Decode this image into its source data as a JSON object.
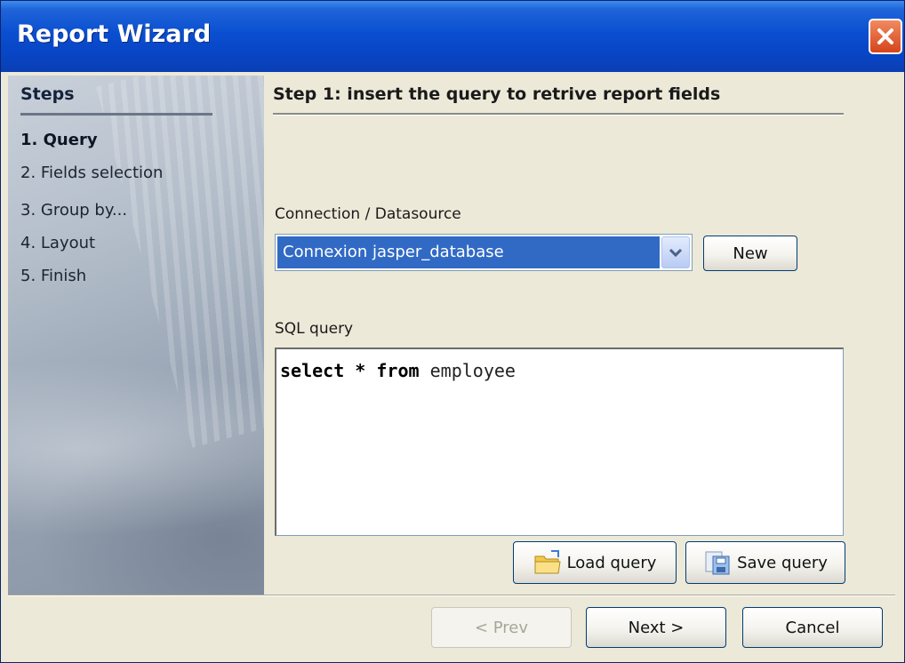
{
  "window": {
    "title": "Report Wizard"
  },
  "steps": {
    "title": "Steps",
    "items": [
      {
        "label": "1. Query",
        "active": true
      },
      {
        "label": "2. Fields selection",
        "active": false
      },
      {
        "label": "3. Group by...",
        "active": false
      },
      {
        "label": "4. Layout",
        "active": false
      },
      {
        "label": "5. Finish",
        "active": false
      }
    ]
  },
  "content": {
    "title": "Step 1: insert the query to retrive report fields",
    "connection_label": "Connection / Datasource",
    "connection_value": "Connexion jasper_database",
    "new_button": "New",
    "sql_label": "SQL query",
    "sql_keyword_1": "select",
    "sql_operator": "*",
    "sql_keyword_2": "from",
    "sql_table": "employee",
    "load_query_button": "Load query",
    "save_query_button": "Save query"
  },
  "footer": {
    "prev_button": "< Prev",
    "next_button": "Next >",
    "cancel_button": "Cancel"
  },
  "colors": {
    "title_bar": "#0a4fd0",
    "selection": "#316ac5",
    "close_button": "#d5441c",
    "dialog_bg": "#ece9d8"
  },
  "icons": [
    "close-icon",
    "dropdown-arrow-icon",
    "load-query-icon",
    "save-query-icon"
  ]
}
